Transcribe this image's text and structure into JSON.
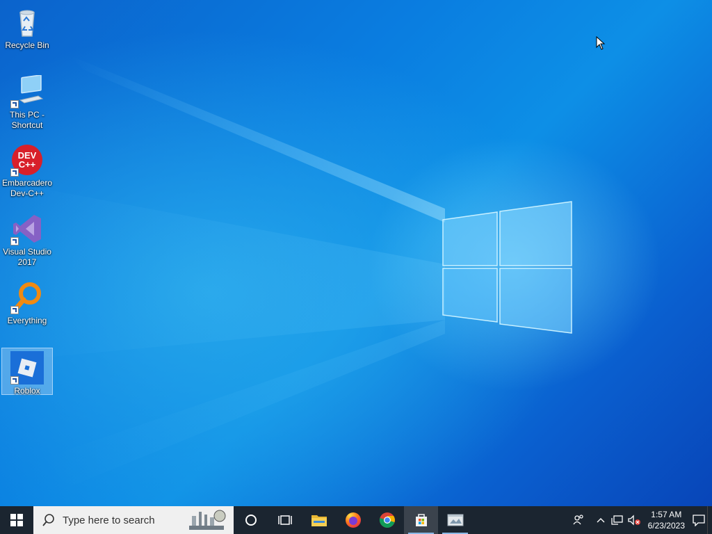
{
  "desktop": {
    "icons": [
      {
        "label": "Recycle Bin",
        "icon": "recycle-bin-icon",
        "shortcut": false
      },
      {
        "label": "This PC -\nShortcut",
        "icon": "this-pc-icon",
        "shortcut": true
      },
      {
        "label": "Embarcadero\nDev-C++",
        "icon": "devcpp-icon",
        "shortcut": true,
        "icon_text": "DEV\nC++"
      },
      {
        "label": "Visual Studio\n2017",
        "icon": "visual-studio-icon",
        "shortcut": true
      },
      {
        "label": "Everything",
        "icon": "everything-search-icon",
        "shortcut": true
      },
      {
        "label": "Roblox",
        "icon": "roblox-icon",
        "shortcut": true,
        "selected": true
      }
    ]
  },
  "taskbar": {
    "search_placeholder": "Type here to search",
    "apps": [
      {
        "name": "cortana",
        "icon": "cortana-circle-icon"
      },
      {
        "name": "task-view",
        "icon": "task-view-icon"
      },
      {
        "name": "file-explorer",
        "icon": "folder-icon"
      },
      {
        "name": "firefox",
        "icon": "firefox-icon"
      },
      {
        "name": "chrome",
        "icon": "chrome-icon"
      },
      {
        "name": "microsoft-store",
        "icon": "store-icon",
        "active": true
      },
      {
        "name": "app-window",
        "icon": "app-window-icon",
        "active": true
      }
    ],
    "tray": {
      "time": "1:57 AM",
      "date": "6/23/2023"
    }
  },
  "colors": {
    "taskbar_bg": "#1b2530",
    "accent": "#0a7de0"
  }
}
